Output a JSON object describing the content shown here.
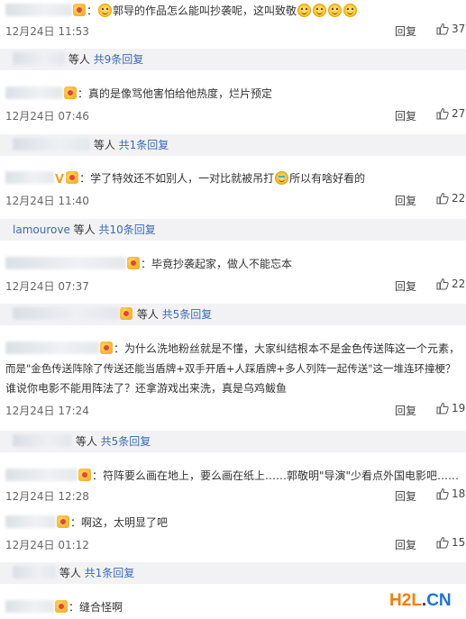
{
  "comments": [
    {
      "text_before": "：",
      "text": "郭导的作品怎么能叫抄袭呢，这叫致敬",
      "date": "12月24日 11:53",
      "reply_label": "回复",
      "likes": "37"
    },
    {
      "text": "：真的是像骂他害怕给他热度，烂片预定",
      "date": "12月24日 07:46",
      "reply_label": "回复",
      "likes": "27"
    },
    {
      "text_a": "：学了特效还不如别人，一对比就被吊打",
      "text_b": "所以有啥好看的",
      "date": "12月24日 11:40",
      "reply_label": "回复",
      "likes": "22"
    },
    {
      "text": "：毕竟抄袭起家，做人不能忘本",
      "date": "12月24日 07:37",
      "reply_label": "回复",
      "likes": "22"
    },
    {
      "line1": "：为什么洗地粉丝就是不懂，大家纠结根本不是金色传送阵这一个元素，",
      "line2": "而是\"金色传送阵除了传送还能当盾牌+双手开盾+人踩盾牌+多人列阵一起传送\"这一堆连环撞梗？",
      "line3": "谁说你电影不能用阵法了？还拿游戏出来洗，真是乌鸡鲅鱼",
      "date": "12月24日 17:24",
      "reply_label": "回复",
      "likes": "19"
    },
    {
      "text": "：符阵要么画在地上，要么画在纸上……郭敬明\"导演\"少看点外国电影吧……",
      "date": "12月24日 12:28",
      "reply_label": "回复",
      "likes": "18"
    },
    {
      "text": "：啊这，太明显了吧",
      "date": "12月24日 01:12",
      "reply_label": "回复",
      "likes": "15"
    },
    {
      "text": "：缝合怪啊"
    }
  ],
  "subreplies": [
    {
      "name": "",
      "suffix": "等人",
      "count": "共9条回复"
    },
    {
      "name": "",
      "suffix": "等人",
      "count": "共1条回复"
    },
    {
      "name": "lamourove",
      "suffix": "等人",
      "count": "共10条回复"
    },
    {
      "name": "",
      "suffix": "等人",
      "count": "共5条回复"
    },
    {
      "name": "",
      "suffix": "等人",
      "count": "共5条回复"
    },
    {
      "name": "",
      "suffix": "等人",
      "count": "共1条回复"
    }
  ],
  "watermark": {
    "h": "H",
    "two": "2",
    "l": "L",
    "dot": ".",
    "cn": "CN"
  }
}
